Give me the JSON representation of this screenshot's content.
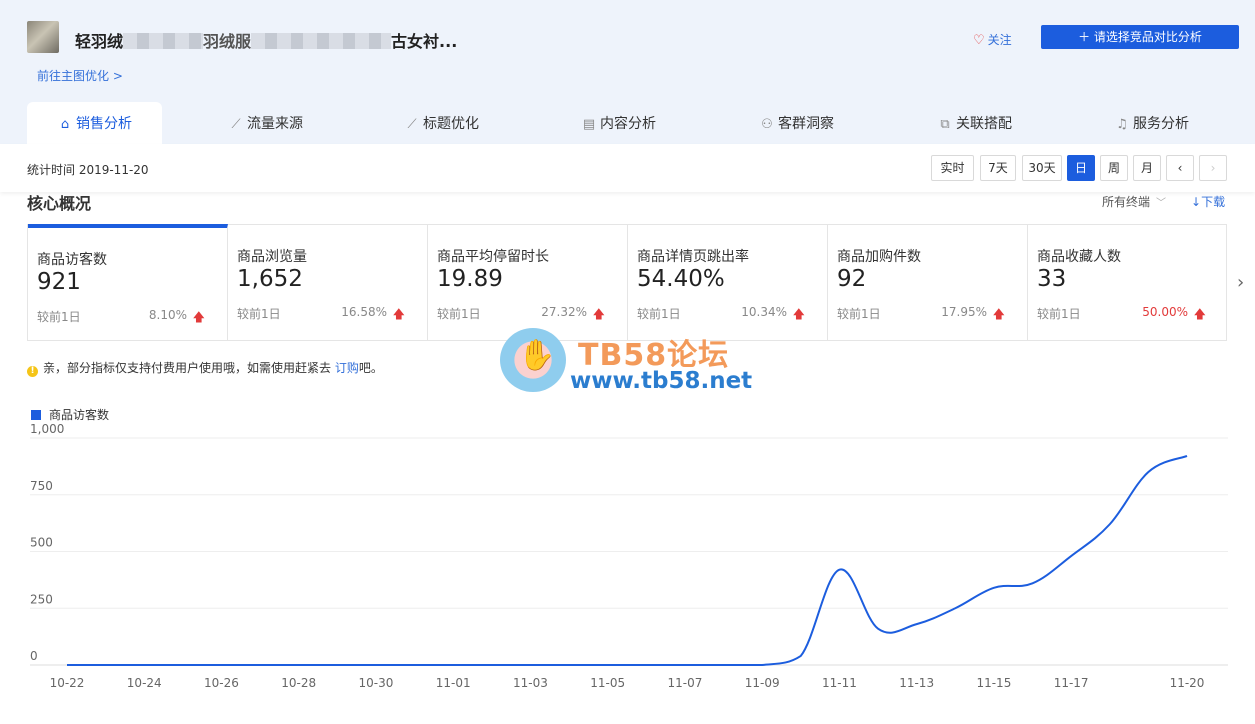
{
  "header": {
    "product_title_start": "轻羽绒",
    "product_title_mid": "羽绒服",
    "product_title_end": "古女衬...",
    "goto_link": "前往主图优化 >",
    "follow_label": "关注",
    "compare_button": "请选择竞品对比分析"
  },
  "tabs": [
    {
      "label": "销售分析",
      "icon": "shopping-bag-icon",
      "active": true
    },
    {
      "label": "流量来源",
      "icon": "line-chart-icon",
      "active": false
    },
    {
      "label": "标题优化",
      "icon": "line-chart-icon",
      "active": false
    },
    {
      "label": "内容分析",
      "icon": "document-icon",
      "active": false
    },
    {
      "label": "客群洞察",
      "icon": "users-icon",
      "active": false
    },
    {
      "label": "关联搭配",
      "icon": "link-icon",
      "active": false
    },
    {
      "label": "服务分析",
      "icon": "headset-icon",
      "active": false
    }
  ],
  "toolbar": {
    "stat_time_label": "统计时间 2019-11-20",
    "periods": [
      "实时",
      "7天",
      "30天",
      "日",
      "周",
      "月"
    ],
    "active_period": "日",
    "prev": "‹",
    "next": "›"
  },
  "overview": {
    "title": "核心概况",
    "terminal": "所有终端",
    "download": "下载"
  },
  "metrics": [
    {
      "label": "商品访客数",
      "value": "921",
      "compare": "较前1日",
      "pct": "8.10%",
      "trend": "up",
      "pct_color": "#888888"
    },
    {
      "label": "商品浏览量",
      "value": "1,652",
      "compare": "较前1日",
      "pct": "16.58%",
      "trend": "up",
      "pct_color": "#888888"
    },
    {
      "label": "商品平均停留时长",
      "value": "19.89",
      "compare": "较前1日",
      "pct": "27.32%",
      "trend": "up",
      "pct_color": "#888888"
    },
    {
      "label": "商品详情页跳出率",
      "value": "54.40%",
      "compare": "较前1日",
      "pct": "10.34%",
      "trend": "up",
      "pct_color": "#888888"
    },
    {
      "label": "商品加购件数",
      "value": "92",
      "compare": "较前1日",
      "pct": "17.95%",
      "trend": "up",
      "pct_color": "#888888"
    },
    {
      "label": "商品收藏人数",
      "value": "33",
      "compare": "较前1日",
      "pct": "50.00%",
      "trend": "up",
      "pct_color": "#e23a3a"
    }
  ],
  "notice": {
    "text": "亲，部分指标仅支持付费用户使用哦，如需使用赶紧去",
    "link": "订购",
    "suffix": "吧。"
  },
  "watermark": {
    "title": "TB58论坛",
    "url": "www.tb58.net"
  },
  "chart_data": {
    "type": "line",
    "legend_position": "top-left",
    "grid": true,
    "ylim": [
      0,
      1000
    ],
    "yticks": [
      "0",
      "250",
      "500",
      "750",
      "1,000"
    ],
    "x": [
      "10-22",
      "10-23",
      "10-24",
      "10-25",
      "10-26",
      "10-27",
      "10-28",
      "10-29",
      "10-30",
      "10-31",
      "11-01",
      "11-02",
      "11-03",
      "11-04",
      "11-05",
      "11-06",
      "11-07",
      "11-08",
      "11-09",
      "11-10",
      "11-11",
      "11-12",
      "11-13",
      "11-14",
      "11-15",
      "11-16",
      "11-17",
      "11-18",
      "11-19",
      "11-20"
    ],
    "xtick_labels": [
      "10-22",
      "10-24",
      "10-26",
      "10-28",
      "10-30",
      "11-01",
      "11-03",
      "11-05",
      "11-07",
      "11-09",
      "11-11",
      "11-13",
      "11-15",
      "11-17",
      "11-20"
    ],
    "series": [
      {
        "name": "商品访客数",
        "color": "#1c5dde",
        "values": [
          0,
          0,
          0,
          0,
          0,
          0,
          0,
          0,
          0,
          0,
          0,
          0,
          0,
          0,
          0,
          0,
          0,
          0,
          0,
          40,
          420,
          160,
          180,
          250,
          340,
          360,
          480,
          620,
          850,
          921
        ]
      }
    ]
  }
}
